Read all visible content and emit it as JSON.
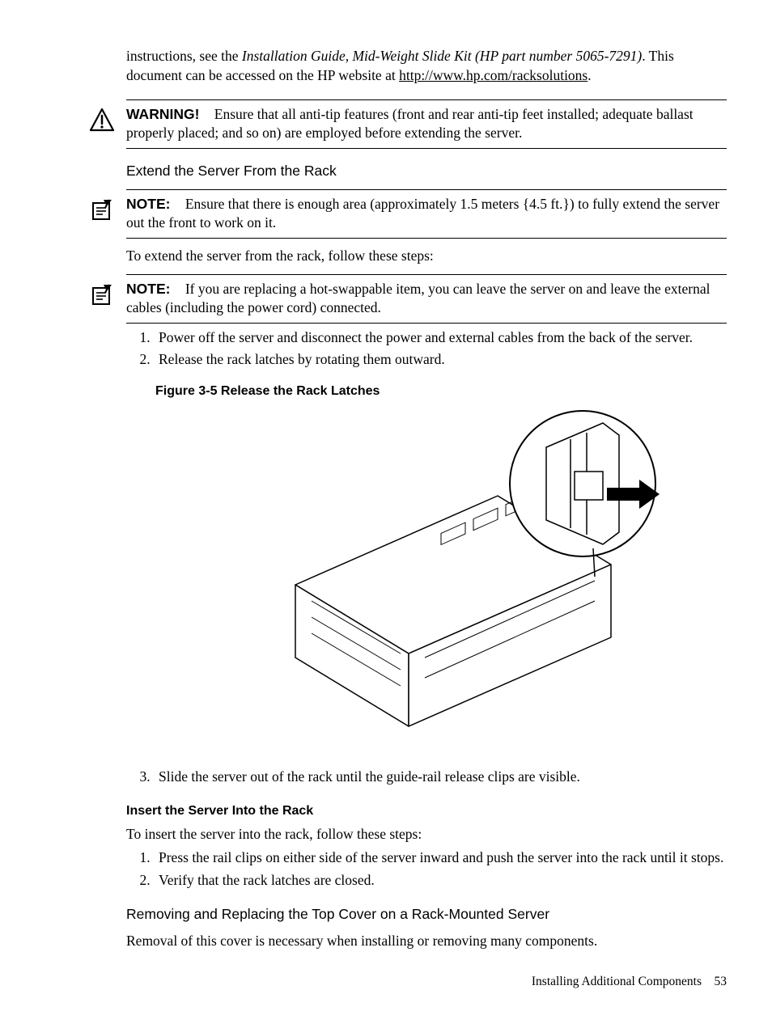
{
  "intro": {
    "p1_a": "instructions, see the ",
    "p1_italic": "Installation Guide, Mid-Weight Slide Kit (HP part number 5065-7291)",
    "p1_b": ". This document can be accessed on the HP website at ",
    "p1_link": "http://www.hp.com/racksolutions",
    "p1_c": "."
  },
  "warning": {
    "label": "WARNING!",
    "text": "Ensure that all anti-tip features (front and rear anti-tip feet installed; adequate ballast properly placed; and so on) are employed before extending the server."
  },
  "section1": {
    "title": "Extend the Server From the Rack"
  },
  "note1": {
    "label": "NOTE:",
    "text": "Ensure that there is enough area (approximately 1.5 meters {4.5 ft.}) to fully extend the server out the front to work on it."
  },
  "para1": "To extend the server from the rack, follow these steps:",
  "note2": {
    "label": "NOTE:",
    "text": "If you are replacing a hot-swappable item, you can leave the server on and leave the external cables (including the power cord) connected."
  },
  "steps1": {
    "s1": "Power off the server and disconnect the power and external cables from the back of the server.",
    "s2": "Release the rack latches by rotating them outward."
  },
  "figure": {
    "caption": "Figure 3-5 Release the Rack Latches"
  },
  "steps1b": {
    "s3": "Slide the server out of the rack until the guide-rail release clips are visible."
  },
  "section2": {
    "title": "Insert the Server Into the Rack",
    "intro": "To insert the server into the rack, follow these steps:",
    "s1": "Press the rail clips on either side of the server inward and push the server into the rack until it stops.",
    "s2": "Verify that the rack latches are closed."
  },
  "section3": {
    "title": "Removing and Replacing the Top Cover on a Rack-Mounted Server",
    "text": "Removal of this cover is necessary when installing or removing many components."
  },
  "footer": {
    "text": "Installing Additional Components",
    "page": "53"
  }
}
